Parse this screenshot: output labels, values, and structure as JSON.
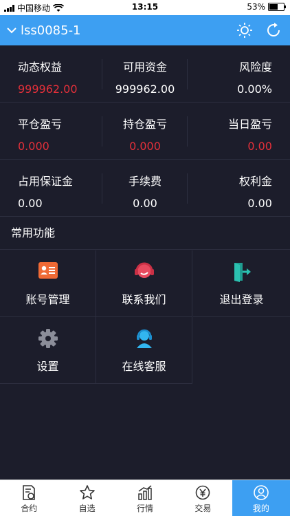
{
  "status_bar": {
    "carrier": "中国移动",
    "time": "13:15",
    "battery": "53%",
    "battery_level": 0.53
  },
  "header": {
    "account": "lss0085-1"
  },
  "metrics": [
    [
      {
        "label": "动态权益",
        "value": "999962.00",
        "color": "red"
      },
      {
        "label": "可用资金",
        "value": "999962.00",
        "color": "white"
      },
      {
        "label": "风险度",
        "value": "0.00%",
        "color": "white"
      }
    ],
    [
      {
        "label": "平仓盈亏",
        "value": "0.000",
        "color": "red"
      },
      {
        "label": "持仓盈亏",
        "value": "0.000",
        "color": "red"
      },
      {
        "label": "当日盈亏",
        "value": "0.00",
        "color": "red"
      }
    ],
    [
      {
        "label": "占用保证金",
        "value": "0.00",
        "color": "white"
      },
      {
        "label": "手续费",
        "value": "0.00",
        "color": "white"
      },
      {
        "label": "权利金",
        "value": "0.00",
        "color": "white"
      }
    ]
  ],
  "functions_title": "常用功能",
  "functions": [
    {
      "label": "账号管理",
      "icon": "id-card-icon"
    },
    {
      "label": "联系我们",
      "icon": "headset-icon"
    },
    {
      "label": "退出登录",
      "icon": "logout-icon"
    },
    {
      "label": "设置",
      "icon": "gear-icon"
    },
    {
      "label": "在线客服",
      "icon": "support-agent-icon"
    }
  ],
  "tabs": [
    {
      "label": "合约",
      "icon": "contract-icon",
      "active": false
    },
    {
      "label": "自选",
      "icon": "star-icon",
      "active": false
    },
    {
      "label": "行情",
      "icon": "chart-icon",
      "active": false
    },
    {
      "label": "交易",
      "icon": "yen-icon",
      "active": false
    },
    {
      "label": "我的",
      "icon": "user-icon",
      "active": true
    }
  ],
  "colors": {
    "accent": "#3d9ff2",
    "background": "#1c1d2b",
    "loss": "#e5303a",
    "divider": "#2d2f40"
  }
}
